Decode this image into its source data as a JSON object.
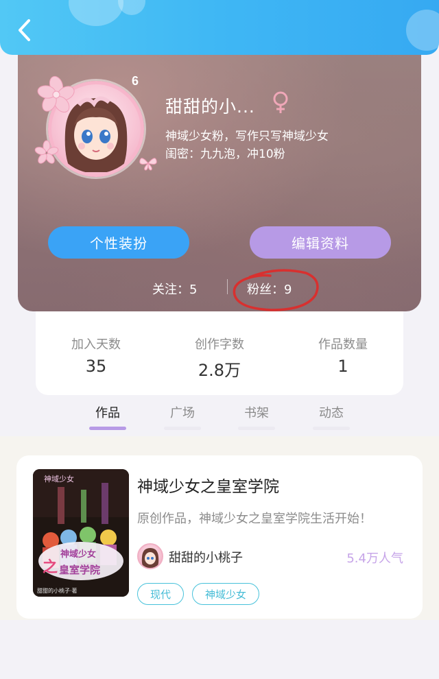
{
  "header": {
    "back_icon": "chevron-left-icon"
  },
  "profile": {
    "level": "6",
    "username": "甜甜的小...",
    "gender_icon": "female-icon",
    "bio_lines": [
      "神域少女粉，写作只写神域少女",
      "闺密：九九泡，冲10粉"
    ],
    "buttons": {
      "decorate": "个性装扮",
      "edit": "编辑资料"
    },
    "following": "关注：5",
    "fans": "粉丝：9",
    "colors": {
      "decorate_button": "#3aa3f6",
      "edit_button": "#b79ae6",
      "annotation_circle": "#d8302f"
    }
  },
  "stats": [
    {
      "label": "加入天数",
      "value": "35"
    },
    {
      "label": "创作字数",
      "value": "2.8万"
    },
    {
      "label": "作品数量",
      "value": "1"
    }
  ],
  "tabs": [
    {
      "label": "作品",
      "active": true
    },
    {
      "label": "广场",
      "active": false
    },
    {
      "label": "书架",
      "active": false
    },
    {
      "label": "动态",
      "active": false
    }
  ],
  "book": {
    "title": "神域少女之皇室学院",
    "description": "原创作品，神域少女之皇室学院生活开始！",
    "author": "甜甜的小桃子",
    "popularity": "5.4万人气",
    "tags": [
      "现代",
      "神域少女"
    ],
    "cover": {
      "logo_text": "神域少女",
      "title_line1": "神域少女",
      "title_line2_a": "之",
      "title_line2_b": "皇室学院",
      "bottom_text": "甜甜的小桃子·著"
    }
  }
}
